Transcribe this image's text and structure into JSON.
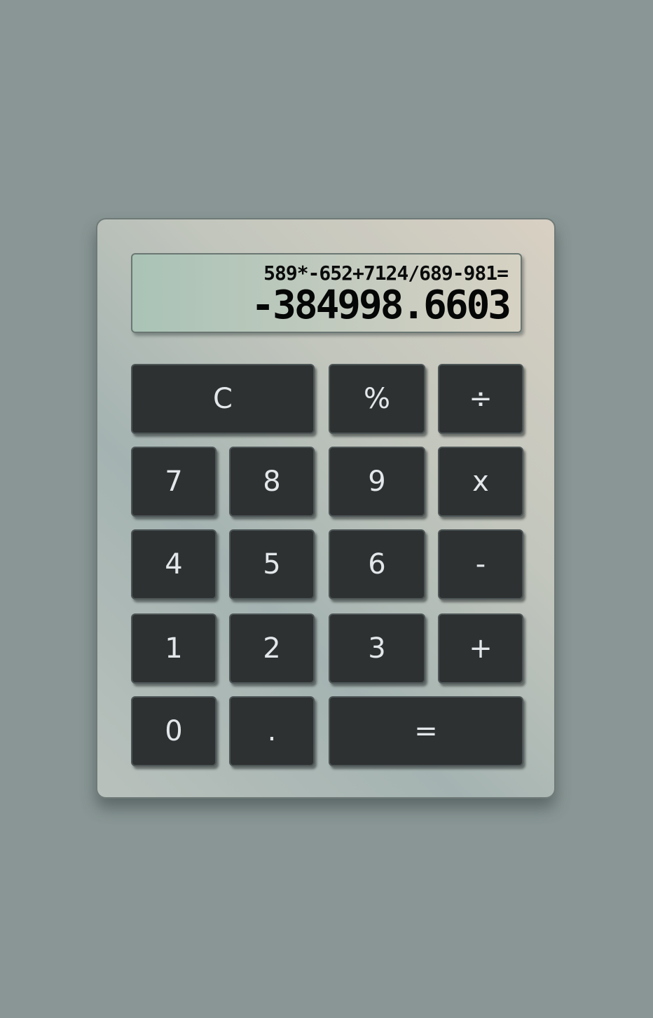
{
  "display": {
    "expression": "589*-652+7124/689-981=",
    "result": "-384998.6603"
  },
  "keys": {
    "clear": "C",
    "percent": "%",
    "divide": "÷",
    "seven": "7",
    "eight": "8",
    "nine": "9",
    "multiply": "x",
    "four": "4",
    "five": "5",
    "six": "6",
    "subtract": "-",
    "one": "1",
    "two": "2",
    "three": "3",
    "add": "+",
    "zero": "0",
    "decimal": ".",
    "equals": "="
  },
  "colors": {
    "background": "#899695",
    "key_face": "#2e3132",
    "key_text": "#e3e7ea",
    "display_text": "#050606"
  }
}
